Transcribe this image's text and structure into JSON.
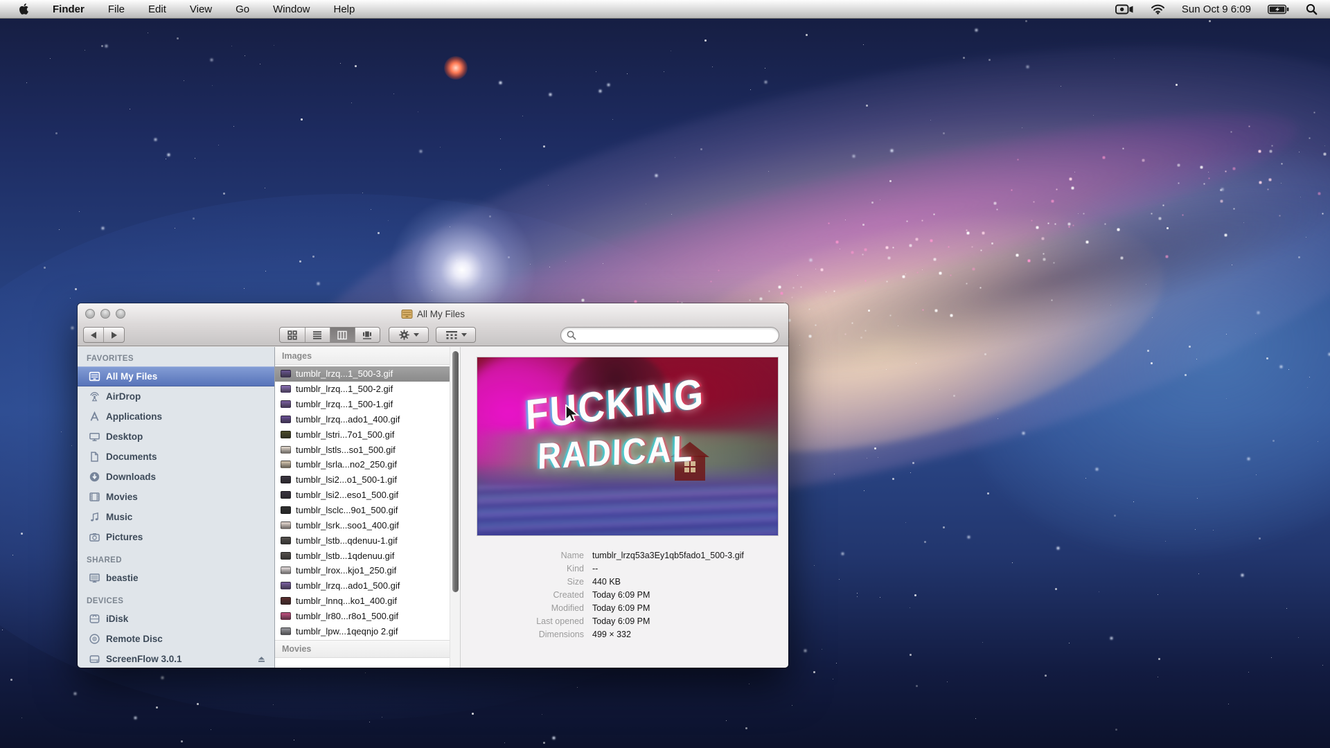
{
  "menu_bar": {
    "apple_icon": "apple-logo-icon",
    "items": [
      {
        "label": "Finder",
        "bold": true
      },
      {
        "label": "File"
      },
      {
        "label": "Edit"
      },
      {
        "label": "View"
      },
      {
        "label": "Go"
      },
      {
        "label": "Window"
      },
      {
        "label": "Help"
      }
    ],
    "status": {
      "icons": [
        "screen-recording-icon",
        "wifi-icon",
        "battery-icon",
        "spotlight-icon"
      ],
      "clock": "Sun Oct 9  6:09"
    }
  },
  "window": {
    "title": "All My Files",
    "title_icon": "all-my-files-icon",
    "toolbar": {
      "back_icon": "back-arrow-icon",
      "forward_icon": "forward-arrow-icon",
      "view_modes": [
        "icon-view",
        "list-view",
        "column-view",
        "coverflow-view"
      ],
      "active_view": "column-view",
      "action_menu_icon": "gear-icon",
      "arrange_menu_icon": "arrange-icon",
      "search": {
        "value": "",
        "placeholder": "",
        "icon": "search-icon"
      }
    },
    "sidebar": {
      "sections": [
        {
          "label": "FAVORITES",
          "items": [
            {
              "label": "All My Files",
              "icon": "all-my-files",
              "selected": true
            },
            {
              "label": "AirDrop",
              "icon": "airdrop"
            },
            {
              "label": "Applications",
              "icon": "applications"
            },
            {
              "label": "Desktop",
              "icon": "desktop"
            },
            {
              "label": "Documents",
              "icon": "documents"
            },
            {
              "label": "Downloads",
              "icon": "downloads"
            },
            {
              "label": "Movies",
              "icon": "movies"
            },
            {
              "label": "Music",
              "icon": "music"
            },
            {
              "label": "Pictures",
              "icon": "pictures"
            }
          ]
        },
        {
          "label": "SHARED",
          "items": [
            {
              "label": "beastie",
              "icon": "display"
            }
          ]
        },
        {
          "label": "DEVICES",
          "items": [
            {
              "label": "iDisk",
              "icon": "idisk"
            },
            {
              "label": "Remote Disc",
              "icon": "remote-disc"
            },
            {
              "label": "ScreenFlow 3.0.1",
              "icon": "drive",
              "eject": true
            }
          ]
        }
      ]
    },
    "file_list": {
      "section": "Images",
      "footer_section": "Movies",
      "files": [
        {
          "name": "tumblr_lrzq...1_500-3.gif",
          "selected": true,
          "thumb": "#6a5590"
        },
        {
          "name": "tumblr_lrzq...1_500-2.gif",
          "thumb": "#8a6fb5"
        },
        {
          "name": "tumblr_lrzq...1_500-1.gif",
          "thumb": "#7a5fa0"
        },
        {
          "name": "tumblr_lrzq...ado1_400.gif",
          "thumb": "#6a4f95"
        },
        {
          "name": "tumblr_lstri...7o1_500.gif",
          "thumb": "#4a4a28"
        },
        {
          "name": "tumblr_lstls...so1_500.gif",
          "thumb": "#e8ded2"
        },
        {
          "name": "tumblr_lsrla...no2_250.gif",
          "thumb": "#d8c8b0"
        },
        {
          "name": "tumblr_lsi2...o1_500-1.gif",
          "thumb": "#3a3440"
        },
        {
          "name": "tumblr_lsi2...eso1_500.gif",
          "thumb": "#3a3440"
        },
        {
          "name": "tumblr_lsclc...9o1_500.gif",
          "thumb": "#2e2e2e"
        },
        {
          "name": "tumblr_lsrk...soo1_400.gif",
          "thumb": "#eadcd4"
        },
        {
          "name": "tumblr_lstb...qdenuu-1.gif",
          "thumb": "#54504c"
        },
        {
          "name": "tumblr_lstb...1qdenuu.gif",
          "thumb": "#54504c"
        },
        {
          "name": "tumblr_lrox...kjo1_250.gif",
          "thumb": "#e8e0e0"
        },
        {
          "name": "tumblr_lrzq...ado1_500.gif",
          "thumb": "#7a5fa0"
        },
        {
          "name": "tumblr_lnnq...ko1_400.gif",
          "thumb": "#5a2e2e"
        },
        {
          "name": "tumblr_lr80...r8o1_500.gif",
          "thumb": "#c05080"
        },
        {
          "name": "tumblr_lpw...1qeqnjo 2.gif",
          "thumb": "#9a9aa0"
        }
      ]
    },
    "preview": {
      "line1": "FUCKING",
      "line2": "RADICAL"
    },
    "info": {
      "rows": [
        {
          "label": "Name",
          "value": "tumblr_lrzq53a3Ey1qb5fado1_500-3.gif",
          "wrap": true
        },
        {
          "label": "Kind",
          "value": "--"
        },
        {
          "label": "Size",
          "value": "440 KB"
        },
        {
          "label": "Created",
          "value": "Today 6:09 PM"
        },
        {
          "label": "Modified",
          "value": "Today 6:09 PM"
        },
        {
          "label": "Last opened",
          "value": "Today 6:09 PM"
        },
        {
          "label": "Dimensions",
          "value": "499 × 332"
        }
      ]
    }
  },
  "colors": {
    "sidebar_selection": "#5874ba",
    "file_selection_inactive": "#8c8c8c",
    "preview_magenta": "#e016c8",
    "preview_crimson": "#7c1030",
    "preview_purple": "#4343a0",
    "menubar_gray": "#d6d6d6"
  }
}
